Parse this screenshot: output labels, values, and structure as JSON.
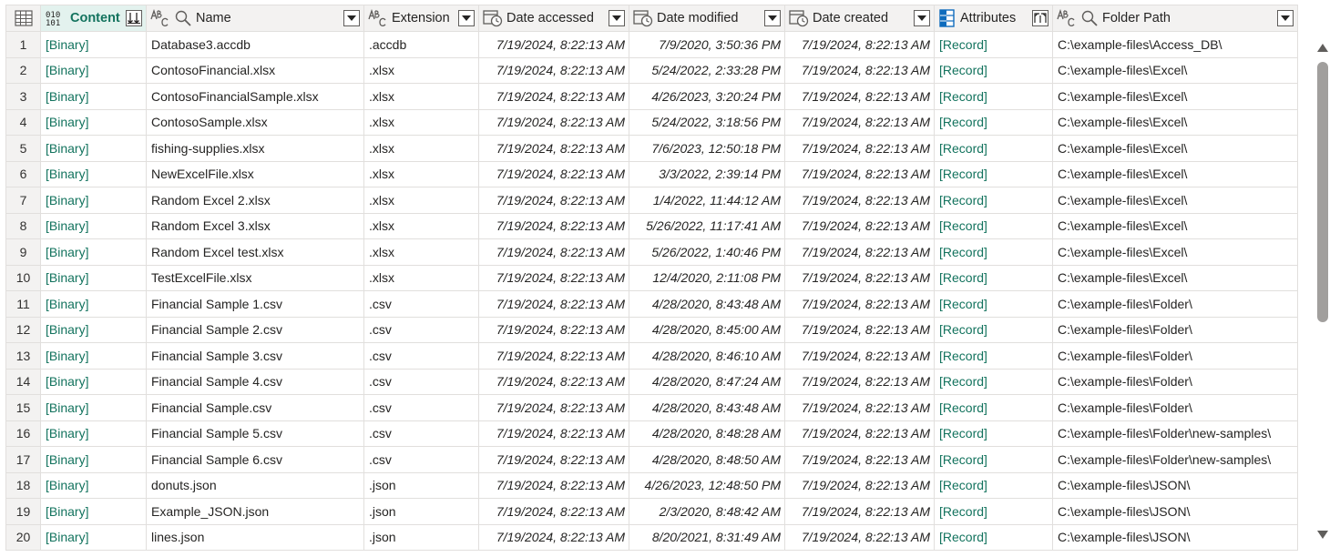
{
  "columns": [
    {
      "key": "content",
      "label": "Content",
      "type": "binary",
      "button": "sort-expand"
    },
    {
      "key": "name",
      "label": "Name",
      "type": "text-search",
      "button": "dropdown"
    },
    {
      "key": "extension",
      "label": "Extension",
      "type": "text",
      "button": "dropdown"
    },
    {
      "key": "date_accessed",
      "label": "Date accessed",
      "type": "datetime",
      "button": "dropdown"
    },
    {
      "key": "date_modified",
      "label": "Date modified",
      "type": "datetime",
      "button": "dropdown"
    },
    {
      "key": "date_created",
      "label": "Date created",
      "type": "datetime",
      "button": "dropdown"
    },
    {
      "key": "attributes",
      "label": "Attributes",
      "type": "table",
      "button": "expand"
    },
    {
      "key": "folder_path",
      "label": "Folder Path",
      "type": "text-search",
      "button": "dropdown"
    }
  ],
  "type_icons": {
    "binary_line1": "010",
    "binary_line2": "101"
  },
  "rows": [
    {
      "n": "1",
      "content": "[Binary]",
      "name": "Database3.accdb",
      "extension": ".accdb",
      "date_accessed": "7/19/2024, 8:22:13 AM",
      "date_modified": "7/9/2020, 3:50:36 PM",
      "date_created": "7/19/2024, 8:22:13 AM",
      "attributes": "[Record]",
      "folder_path": "C:\\example-files\\Access_DB\\"
    },
    {
      "n": "2",
      "content": "[Binary]",
      "name": "ContosoFinancial.xlsx",
      "extension": ".xlsx",
      "date_accessed": "7/19/2024, 8:22:13 AM",
      "date_modified": "5/24/2022, 2:33:28 PM",
      "date_created": "7/19/2024, 8:22:13 AM",
      "attributes": "[Record]",
      "folder_path": "C:\\example-files\\Excel\\"
    },
    {
      "n": "3",
      "content": "[Binary]",
      "name": "ContosoFinancialSample.xlsx",
      "extension": ".xlsx",
      "date_accessed": "7/19/2024, 8:22:13 AM",
      "date_modified": "4/26/2023, 3:20:24 PM",
      "date_created": "7/19/2024, 8:22:13 AM",
      "attributes": "[Record]",
      "folder_path": "C:\\example-files\\Excel\\"
    },
    {
      "n": "4",
      "content": "[Binary]",
      "name": "ContosoSample.xlsx",
      "extension": ".xlsx",
      "date_accessed": "7/19/2024, 8:22:13 AM",
      "date_modified": "5/24/2022, 3:18:56 PM",
      "date_created": "7/19/2024, 8:22:13 AM",
      "attributes": "[Record]",
      "folder_path": "C:\\example-files\\Excel\\"
    },
    {
      "n": "5",
      "content": "[Binary]",
      "name": "fishing-supplies.xlsx",
      "extension": ".xlsx",
      "date_accessed": "7/19/2024, 8:22:13 AM",
      "date_modified": "7/6/2023, 12:50:18 PM",
      "date_created": "7/19/2024, 8:22:13 AM",
      "attributes": "[Record]",
      "folder_path": "C:\\example-files\\Excel\\"
    },
    {
      "n": "6",
      "content": "[Binary]",
      "name": "NewExcelFile.xlsx",
      "extension": ".xlsx",
      "date_accessed": "7/19/2024, 8:22:13 AM",
      "date_modified": "3/3/2022, 2:39:14 PM",
      "date_created": "7/19/2024, 8:22:13 AM",
      "attributes": "[Record]",
      "folder_path": "C:\\example-files\\Excel\\"
    },
    {
      "n": "7",
      "content": "[Binary]",
      "name": "Random Excel 2.xlsx",
      "extension": ".xlsx",
      "date_accessed": "7/19/2024, 8:22:13 AM",
      "date_modified": "1/4/2022, 11:44:12 AM",
      "date_created": "7/19/2024, 8:22:13 AM",
      "attributes": "[Record]",
      "folder_path": "C:\\example-files\\Excel\\"
    },
    {
      "n": "8",
      "content": "[Binary]",
      "name": "Random Excel 3.xlsx",
      "extension": ".xlsx",
      "date_accessed": "7/19/2024, 8:22:13 AM",
      "date_modified": "5/26/2022, 11:17:41 AM",
      "date_created": "7/19/2024, 8:22:13 AM",
      "attributes": "[Record]",
      "folder_path": "C:\\example-files\\Excel\\"
    },
    {
      "n": "9",
      "content": "[Binary]",
      "name": "Random Excel test.xlsx",
      "extension": ".xlsx",
      "date_accessed": "7/19/2024, 8:22:13 AM",
      "date_modified": "5/26/2022, 1:40:46 PM",
      "date_created": "7/19/2024, 8:22:13 AM",
      "attributes": "[Record]",
      "folder_path": "C:\\example-files\\Excel\\"
    },
    {
      "n": "10",
      "content": "[Binary]",
      "name": "TestExcelFile.xlsx",
      "extension": ".xlsx",
      "date_accessed": "7/19/2024, 8:22:13 AM",
      "date_modified": "12/4/2020, 2:11:08 PM",
      "date_created": "7/19/2024, 8:22:13 AM",
      "attributes": "[Record]",
      "folder_path": "C:\\example-files\\Excel\\"
    },
    {
      "n": "11",
      "content": "[Binary]",
      "name": "Financial Sample 1.csv",
      "extension": ".csv",
      "date_accessed": "7/19/2024, 8:22:13 AM",
      "date_modified": "4/28/2020, 8:43:48 AM",
      "date_created": "7/19/2024, 8:22:13 AM",
      "attributes": "[Record]",
      "folder_path": "C:\\example-files\\Folder\\"
    },
    {
      "n": "12",
      "content": "[Binary]",
      "name": "Financial Sample 2.csv",
      "extension": ".csv",
      "date_accessed": "7/19/2024, 8:22:13 AM",
      "date_modified": "4/28/2020, 8:45:00 AM",
      "date_created": "7/19/2024, 8:22:13 AM",
      "attributes": "[Record]",
      "folder_path": "C:\\example-files\\Folder\\"
    },
    {
      "n": "13",
      "content": "[Binary]",
      "name": "Financial Sample 3.csv",
      "extension": ".csv",
      "date_accessed": "7/19/2024, 8:22:13 AM",
      "date_modified": "4/28/2020, 8:46:10 AM",
      "date_created": "7/19/2024, 8:22:13 AM",
      "attributes": "[Record]",
      "folder_path": "C:\\example-files\\Folder\\"
    },
    {
      "n": "14",
      "content": "[Binary]",
      "name": "Financial Sample 4.csv",
      "extension": ".csv",
      "date_accessed": "7/19/2024, 8:22:13 AM",
      "date_modified": "4/28/2020, 8:47:24 AM",
      "date_created": "7/19/2024, 8:22:13 AM",
      "attributes": "[Record]",
      "folder_path": "C:\\example-files\\Folder\\"
    },
    {
      "n": "15",
      "content": "[Binary]",
      "name": "Financial Sample.csv",
      "extension": ".csv",
      "date_accessed": "7/19/2024, 8:22:13 AM",
      "date_modified": "4/28/2020, 8:43:48 AM",
      "date_created": "7/19/2024, 8:22:13 AM",
      "attributes": "[Record]",
      "folder_path": "C:\\example-files\\Folder\\"
    },
    {
      "n": "16",
      "content": "[Binary]",
      "name": "Financial Sample 5.csv",
      "extension": ".csv",
      "date_accessed": "7/19/2024, 8:22:13 AM",
      "date_modified": "4/28/2020, 8:48:28 AM",
      "date_created": "7/19/2024, 8:22:13 AM",
      "attributes": "[Record]",
      "folder_path": "C:\\example-files\\Folder\\new-samples\\"
    },
    {
      "n": "17",
      "content": "[Binary]",
      "name": "Financial Sample 6.csv",
      "extension": ".csv",
      "date_accessed": "7/19/2024, 8:22:13 AM",
      "date_modified": "4/28/2020, 8:48:50 AM",
      "date_created": "7/19/2024, 8:22:13 AM",
      "attributes": "[Record]",
      "folder_path": "C:\\example-files\\Folder\\new-samples\\"
    },
    {
      "n": "18",
      "content": "[Binary]",
      "name": "donuts.json",
      "extension": ".json",
      "date_accessed": "7/19/2024, 8:22:13 AM",
      "date_modified": "4/26/2023, 12:48:50 PM",
      "date_created": "7/19/2024, 8:22:13 AM",
      "attributes": "[Record]",
      "folder_path": "C:\\example-files\\JSON\\"
    },
    {
      "n": "19",
      "content": "[Binary]",
      "name": "Example_JSON.json",
      "extension": ".json",
      "date_accessed": "7/19/2024, 8:22:13 AM",
      "date_modified": "2/3/2020, 8:48:42 AM",
      "date_created": "7/19/2024, 8:22:13 AM",
      "attributes": "[Record]",
      "folder_path": "C:\\example-files\\JSON\\"
    },
    {
      "n": "20",
      "content": "[Binary]",
      "name": "lines.json",
      "extension": ".json",
      "date_accessed": "7/19/2024, 8:22:13 AM",
      "date_modified": "8/20/2021, 8:31:49 AM",
      "date_created": "7/19/2024, 8:22:13 AM",
      "attributes": "[Record]",
      "folder_path": "C:\\example-files\\JSON\\"
    }
  ],
  "colors": {
    "accent": "#13735e",
    "selected_header": "#e3f2ee",
    "header_bg": "#f3f2f1",
    "gridline": "#e1dfdd",
    "scrollbar_thumb": "#a19f9d"
  }
}
